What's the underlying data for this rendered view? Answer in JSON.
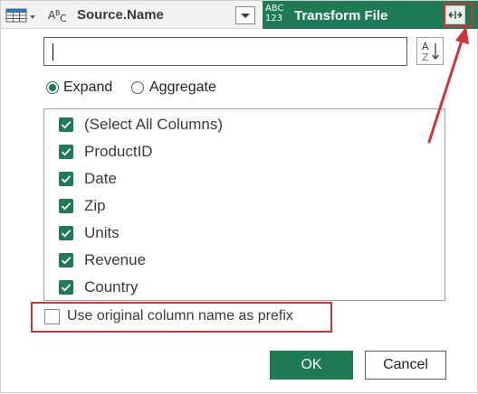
{
  "header": {
    "source_column": {
      "type_icon": "abc-text-type-icon",
      "name": "Source.Name"
    },
    "transform_column": {
      "type_badge_line1": "ABC",
      "type_badge_line2": "123",
      "name": "Transform File",
      "expand_icon": "expand-columns-icon"
    },
    "table_icon": "table-icon"
  },
  "panel": {
    "search": {
      "value": "",
      "placeholder": ""
    },
    "sort_icon": "sort-a-z-icon",
    "mode_options": [
      {
        "label": "Expand",
        "selected": true
      },
      {
        "label": "Aggregate",
        "selected": false
      }
    ],
    "columns": [
      {
        "label": "(Select All Columns)",
        "checked": true
      },
      {
        "label": "ProductID",
        "checked": true
      },
      {
        "label": "Date",
        "checked": true
      },
      {
        "label": "Zip",
        "checked": true
      },
      {
        "label": "Units",
        "checked": true
      },
      {
        "label": "Revenue",
        "checked": true
      },
      {
        "label": "Country",
        "checked": true
      }
    ],
    "prefix_option": {
      "label": "Use original column name as prefix",
      "checked": false
    },
    "ok_label": "OK",
    "cancel_label": "Cancel"
  },
  "colors": {
    "accent_green": "#1e7b55",
    "highlight_red": "#d13438"
  }
}
